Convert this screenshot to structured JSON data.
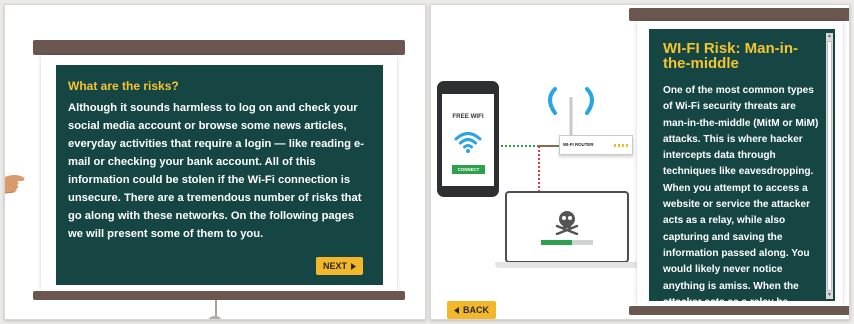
{
  "left_slide": {
    "heading": "What are the risks?",
    "body": "Although it sounds harmless to log on and check your social media account or browse some news articles, everyday activities that require a login — like reading e-mail or checking your bank account. All of this information could be stolen if the Wi-Fi connection is unsecure. There are a tremendous number of risks that go along with these networks. On the following pages we will present some of them to you.",
    "next_label": "NEXT"
  },
  "right_slide": {
    "heading": "WI-FI Risk: Man-in-the-middle",
    "body": "One of the most common types of Wi-Fi security threats are man-in-the-middle (MitM or MiM) attacks. This is where hacker intercepts data through techniques like eavesdropping. When you attempt to access a website or service the attacker acts as a relay, while also capturing and saving the information passed along. You would likely never notice anything is amiss. When the attacker acts as a relay he",
    "back_label": "BACK"
  },
  "illustration": {
    "phone_title": "FREE WIFI",
    "phone_button": "CONNECT",
    "router_label": "WI-FI ROUTER",
    "laptop_progress": 0.6
  },
  "colors": {
    "board": "#164643",
    "accent": "#f3b72c",
    "heading": "#f4c430",
    "wifi_blue": "#2aa4e3",
    "connect_green": "#2ea04c",
    "danger_red": "#e23b3b"
  },
  "icons": {
    "next": "chevron-right-icon",
    "back": "chevron-left-icon",
    "wifi": "wifi-icon",
    "skull": "skull-crossbones-icon",
    "hand": "pointing-hand-icon"
  }
}
